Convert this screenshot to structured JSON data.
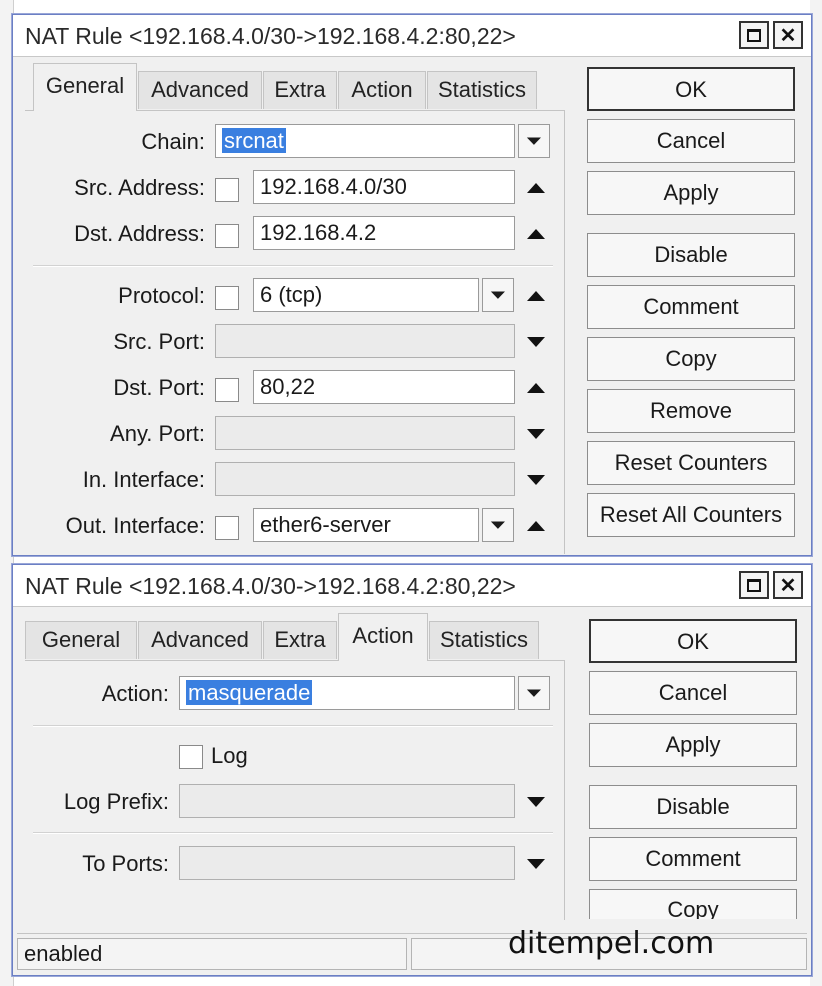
{
  "window1": {
    "title": "NAT Rule <192.168.4.0/30->192.168.4.2:80,22>",
    "tabs": [
      "General",
      "Advanced",
      "Extra",
      "Action",
      "Statistics"
    ],
    "active_tab": "General",
    "fields": {
      "chain_label": "Chain:",
      "chain_value": "srcnat",
      "src_address_label": "Src. Address:",
      "src_address_value": "192.168.4.0/30",
      "dst_address_label": "Dst. Address:",
      "dst_address_value": "192.168.4.2",
      "protocol_label": "Protocol:",
      "protocol_value": "6 (tcp)",
      "src_port_label": "Src. Port:",
      "dst_port_label": "Dst. Port:",
      "dst_port_value": "80,22",
      "any_port_label": "Any. Port:",
      "in_interface_label": "In. Interface:",
      "out_interface_label": "Out. Interface:",
      "out_interface_value": "ether6-server"
    },
    "buttons": [
      "OK",
      "Cancel",
      "Apply",
      "Disable",
      "Comment",
      "Copy",
      "Remove",
      "Reset Counters",
      "Reset All Counters"
    ]
  },
  "window2": {
    "title": "NAT Rule <192.168.4.0/30->192.168.4.2:80,22>",
    "tabs": [
      "General",
      "Advanced",
      "Extra",
      "Action",
      "Statistics"
    ],
    "active_tab": "Action",
    "fields": {
      "action_label": "Action:",
      "action_value": "masquerade",
      "log_label": "Log",
      "log_prefix_label": "Log Prefix:",
      "to_ports_label": "To Ports:"
    },
    "buttons": [
      "OK",
      "Cancel",
      "Apply",
      "Disable",
      "Comment",
      "Copy"
    ],
    "status": "enabled"
  },
  "watermark": "ditempel.com",
  "colors": {
    "selection": "#3a7fe0",
    "window_border": "#6b7fc4"
  }
}
